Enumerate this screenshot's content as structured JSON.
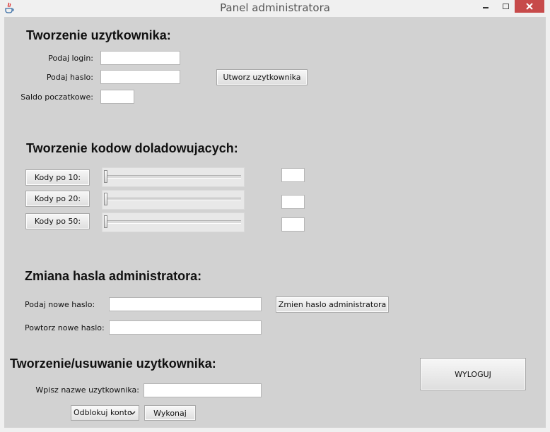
{
  "window": {
    "title": "Panel administratora"
  },
  "create_user": {
    "heading": "Tworzenie uzytkownika:",
    "login_label": "Podaj login:",
    "login_value": "",
    "password_label": "Podaj haslo:",
    "password_value": "",
    "balance_label": "Saldo poczatkowe:",
    "balance_value": "",
    "create_button": "Utworz uzytkownika"
  },
  "codes": {
    "heading": "Tworzenie kodow doladowujacych:",
    "rows": [
      {
        "button": "Kody po 10:",
        "slider_value": 0,
        "count": ""
      },
      {
        "button": "Kody po 20:",
        "slider_value": 0,
        "count": ""
      },
      {
        "button": "Kody po 50:",
        "slider_value": 0,
        "count": ""
      }
    ]
  },
  "admin_password": {
    "heading": "Zmiana hasla administratora:",
    "new_label": "Podaj nowe haslo:",
    "new_value": "",
    "repeat_label": "Powtorz nowe haslo:",
    "repeat_value": "",
    "change_button": "Zmien haslo administratora"
  },
  "manage_user": {
    "heading": "Tworzenie/usuwanie uzytkownika:",
    "name_label": "Wpisz nazwe uzytkownika:",
    "name_value": "",
    "action_selected": "Odblokuj konto",
    "execute_button": "Wykonaj"
  },
  "logout_button": "WYLOGUJ",
  "colors": {
    "close_button": "#c74a4a",
    "panel_bg": "#d2d2d2"
  }
}
